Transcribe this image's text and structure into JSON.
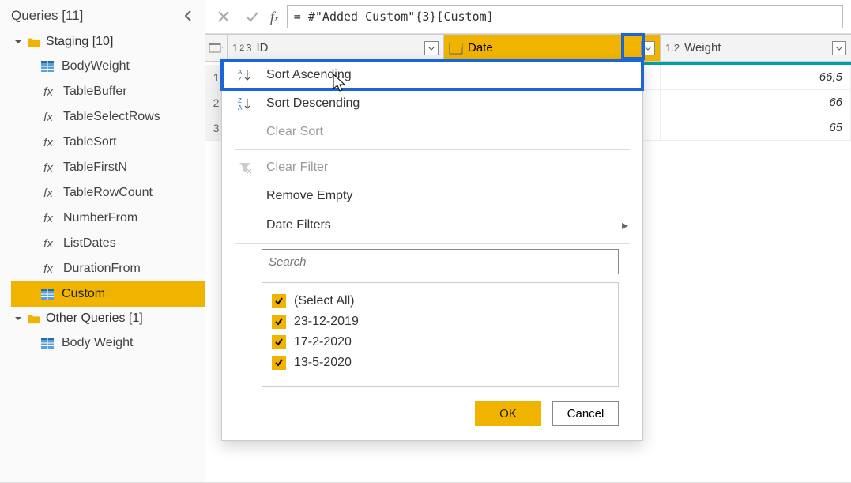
{
  "sidebar": {
    "title": "Queries [11]",
    "groups": [
      {
        "label": "Staging [10]",
        "items": [
          {
            "kind": "table",
            "label": "BodyWeight"
          },
          {
            "kind": "fx",
            "label": "TableBuffer"
          },
          {
            "kind": "fx",
            "label": "TableSelectRows"
          },
          {
            "kind": "fx",
            "label": "TableSort"
          },
          {
            "kind": "fx",
            "label": "TableFirstN"
          },
          {
            "kind": "fx",
            "label": "TableRowCount"
          },
          {
            "kind": "fx",
            "label": "NumberFrom"
          },
          {
            "kind": "fx",
            "label": "ListDates"
          },
          {
            "kind": "fx",
            "label": "DurationFrom"
          },
          {
            "kind": "table",
            "label": "Custom",
            "selected": true
          }
        ]
      },
      {
        "label": "Other Queries [1]",
        "items": [
          {
            "kind": "table",
            "label": "Body Weight"
          }
        ]
      }
    ]
  },
  "formula_bar": {
    "value": "= #\"Added Custom\"{3}[Custom]"
  },
  "grid": {
    "columns": [
      {
        "type": "1²3",
        "name": "ID"
      },
      {
        "type": "date",
        "name": "Date",
        "selected": true
      },
      {
        "type": "1.2",
        "name": "Weight"
      }
    ],
    "rows": [
      {
        "weight": "66,5"
      },
      {
        "weight": "66"
      },
      {
        "weight": "65"
      }
    ]
  },
  "dropdown": {
    "sort_asc": "Sort Ascending",
    "sort_desc": "Sort Descending",
    "clear_sort": "Clear Sort",
    "clear_filter": "Clear Filter",
    "remove_empty": "Remove Empty",
    "date_filters": "Date Filters",
    "search_placeholder": "Search",
    "options": [
      "(Select All)",
      "23-12-2019",
      "17-2-2020",
      "13-5-2020"
    ],
    "ok": "OK",
    "cancel": "Cancel"
  }
}
